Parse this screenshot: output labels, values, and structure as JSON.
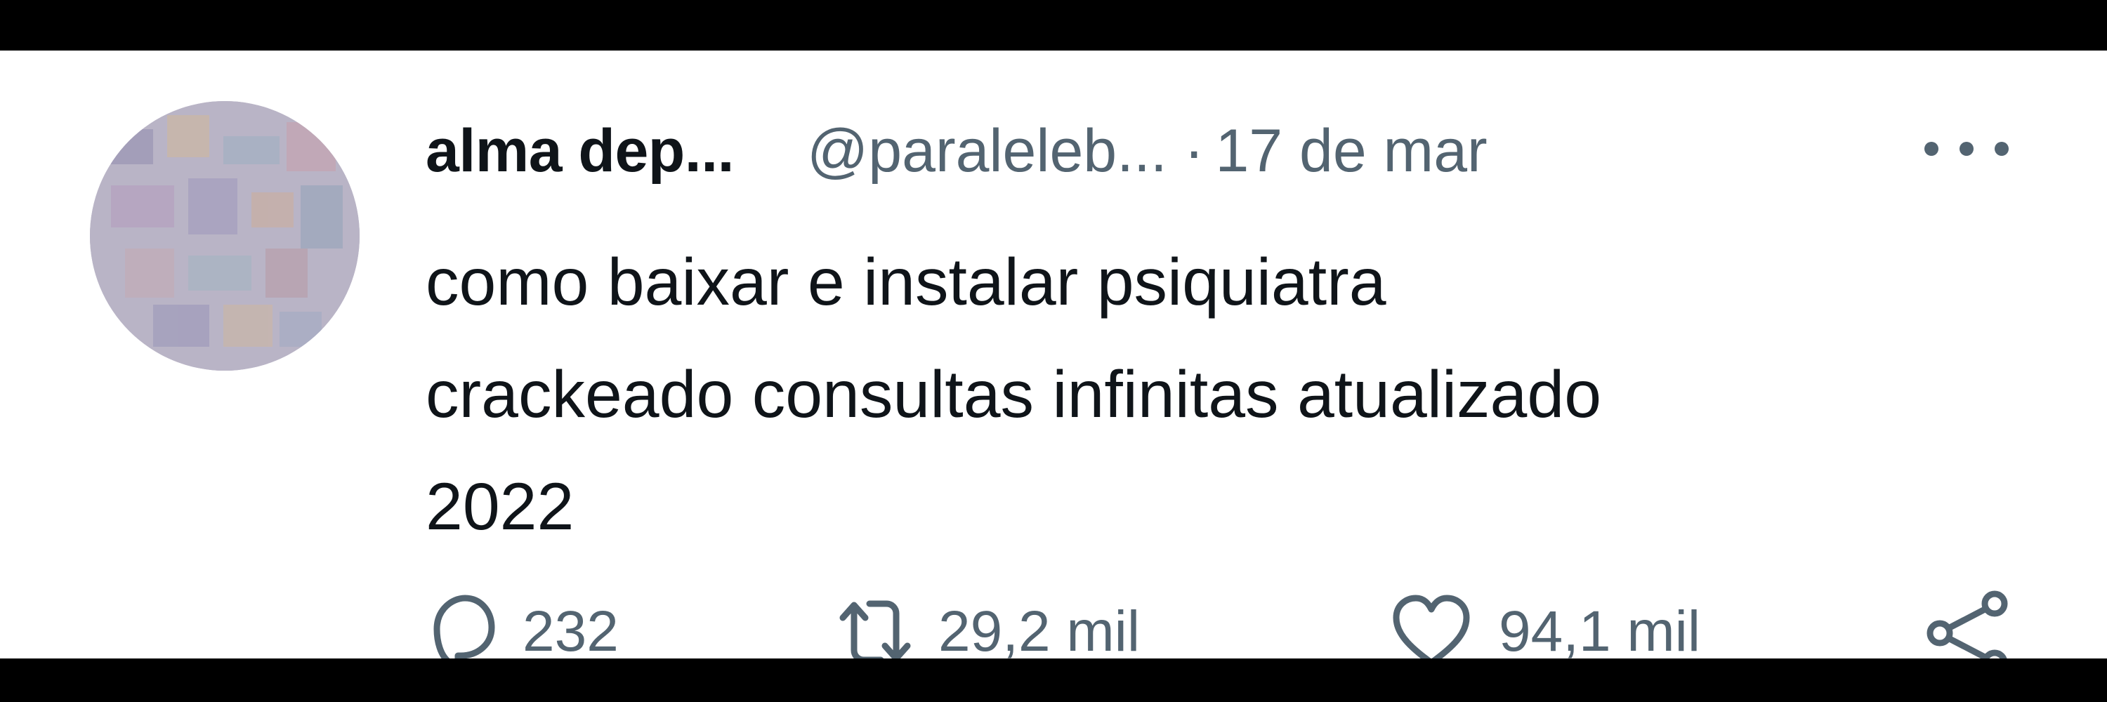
{
  "tweet": {
    "author_name": "alma dep...",
    "author_handle": "@paraleleb...",
    "separator": "·",
    "date": "17 de mar",
    "text": "como baixar e instalar psiquiatra\ncrackeado consultas infinitas atualizado\n2022",
    "avatar_icon": "avatar-icon"
  },
  "actions": {
    "reply": {
      "icon": "reply-icon",
      "count": "232"
    },
    "retweet": {
      "icon": "retweet-icon",
      "count": "29,2 mil"
    },
    "like": {
      "icon": "heart-icon",
      "count": "94,1 mil"
    },
    "share": {
      "icon": "share-icon"
    }
  },
  "more": {
    "icon": "more-icon"
  },
  "colors": {
    "text_primary": "#0f1419",
    "text_secondary": "#536471",
    "background": "#ffffff",
    "frame": "#000000"
  }
}
